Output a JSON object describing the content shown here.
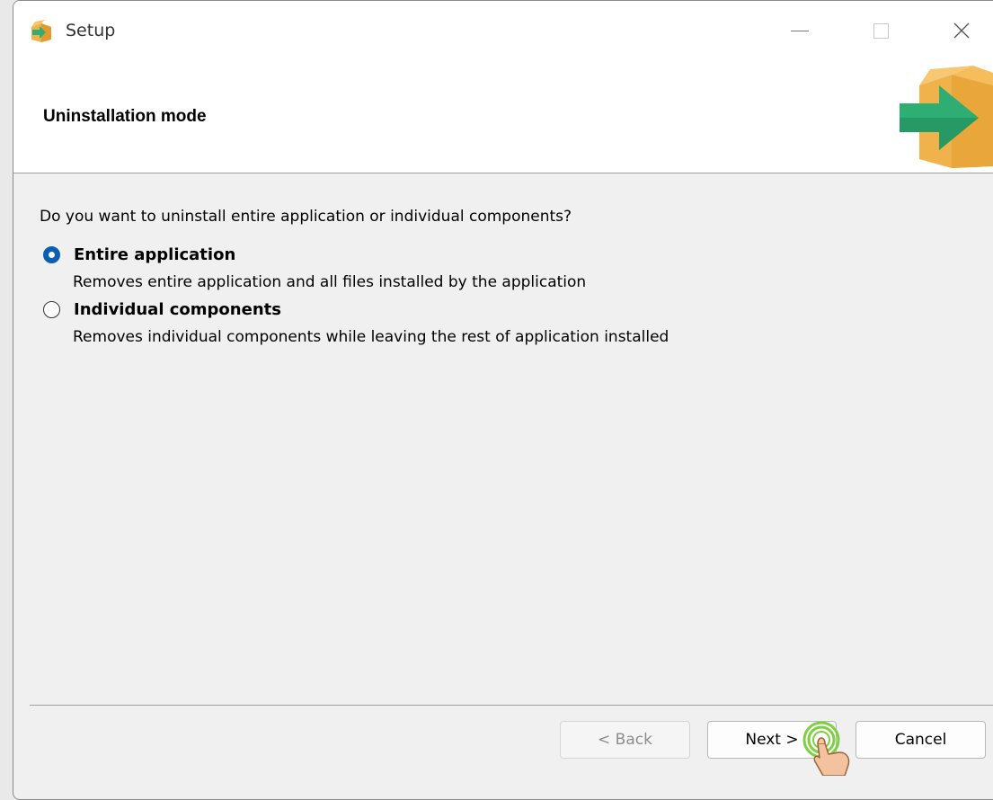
{
  "window": {
    "title": "Setup"
  },
  "header": {
    "heading": "Uninstallation mode"
  },
  "body": {
    "question": "Do you want to uninstall entire application or individual components?",
    "options": [
      {
        "label": "Entire application",
        "description": "Removes entire application and all files installed by the application",
        "selected": true
      },
      {
        "label": "Individual components",
        "description": "Removes individual components while leaving the rest of application installed",
        "selected": false
      }
    ]
  },
  "footer": {
    "back_label": "< Back",
    "next_label": "Next >",
    "cancel_label": "Cancel",
    "back_enabled": false
  },
  "colors": {
    "radio_accent": "#0a5fb4",
    "box_orange": "#f0b24a",
    "arrow_green": "#2fae74",
    "click_highlight": "#7fd040"
  },
  "icons": [
    "setup-app-icon",
    "minimize-icon",
    "maximize-icon",
    "close-icon",
    "package-arrow-icon",
    "hand-cursor-icon"
  ]
}
